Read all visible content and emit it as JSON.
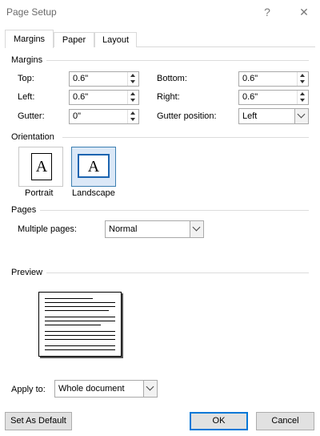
{
  "window": {
    "title": "Page Setup",
    "help_glyph": "?",
    "close_glyph": "✕"
  },
  "tabs": [
    {
      "label": "Margins",
      "active": true
    },
    {
      "label": "Paper",
      "active": false
    },
    {
      "label": "Layout",
      "active": false
    }
  ],
  "margins": {
    "section_label": "Margins",
    "top": {
      "label": "Top:",
      "value": "0.6\""
    },
    "bottom": {
      "label": "Bottom:",
      "value": "0.6\""
    },
    "left": {
      "label": "Left:",
      "value": "0.6\""
    },
    "right": {
      "label": "Right:",
      "value": "0.6\""
    },
    "gutter": {
      "label": "Gutter:",
      "value": "0\""
    },
    "gutter_position": {
      "label": "Gutter position:",
      "value": "Left"
    }
  },
  "orientation": {
    "section_label": "Orientation",
    "portrait_label": "Portrait",
    "landscape_label": "Landscape",
    "selected": "Landscape",
    "glyph": "A"
  },
  "pages": {
    "section_label": "Pages",
    "multiple_pages_label": "Multiple pages:",
    "multiple_pages_value": "Normal"
  },
  "preview": {
    "section_label": "Preview"
  },
  "apply_to": {
    "label": "Apply to:",
    "value": "Whole document"
  },
  "buttons": {
    "set_default": "Set As Default",
    "ok": "OK",
    "cancel": "Cancel"
  },
  "colors": {
    "accent": "#0078d7",
    "selected_fill": "#dbe8f7"
  }
}
